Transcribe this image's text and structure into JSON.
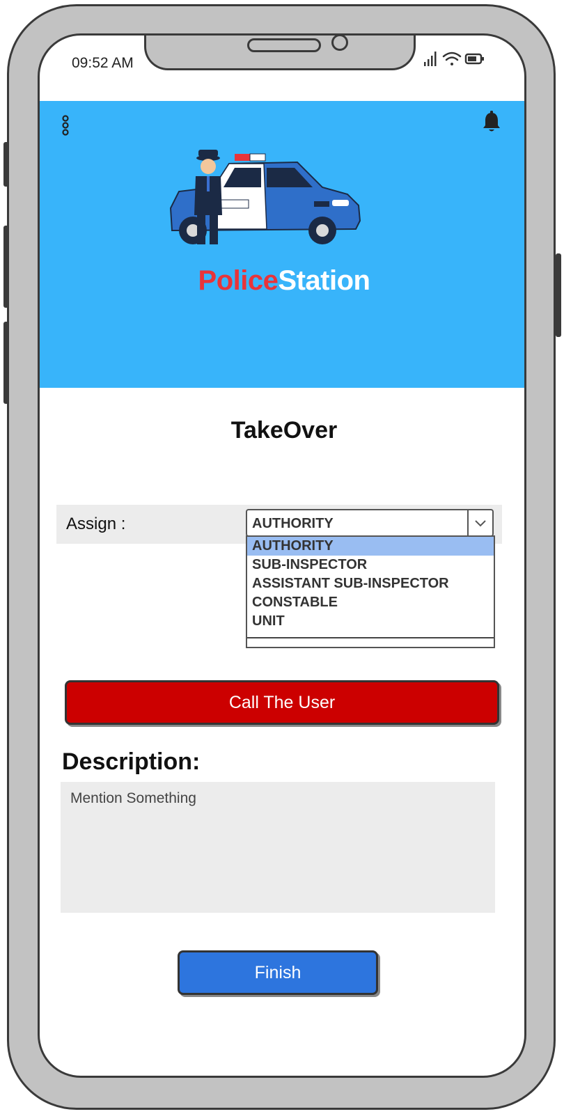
{
  "status_bar": {
    "time": "09:52 AM",
    "icons": [
      "signal-icon",
      "wifi-icon",
      "battery-icon"
    ]
  },
  "header": {
    "menu_icon": "more-vertical-icon",
    "bell_icon": "bell-icon",
    "logo": {
      "part1": "Police",
      "part2": "Station",
      "colors": {
        "police": "#e8343a",
        "station": "#ffffff"
      }
    },
    "background": "#38b4fa"
  },
  "page": {
    "title": "TakeOver"
  },
  "assign": {
    "label": "Assign :",
    "selected": "AUTHORITY",
    "options": [
      "AUTHORITY",
      "SUB-INSPECTOR",
      "ASSISTANT SUB-INSPECTOR",
      "CONSTABLE",
      "UNIT"
    ]
  },
  "call_button": {
    "label": "Call The User",
    "color": "#cc0000"
  },
  "description": {
    "title": "Description:",
    "placeholder": "Mention Something"
  },
  "finish_button": {
    "label": "Finish",
    "color": "#2d75de"
  }
}
